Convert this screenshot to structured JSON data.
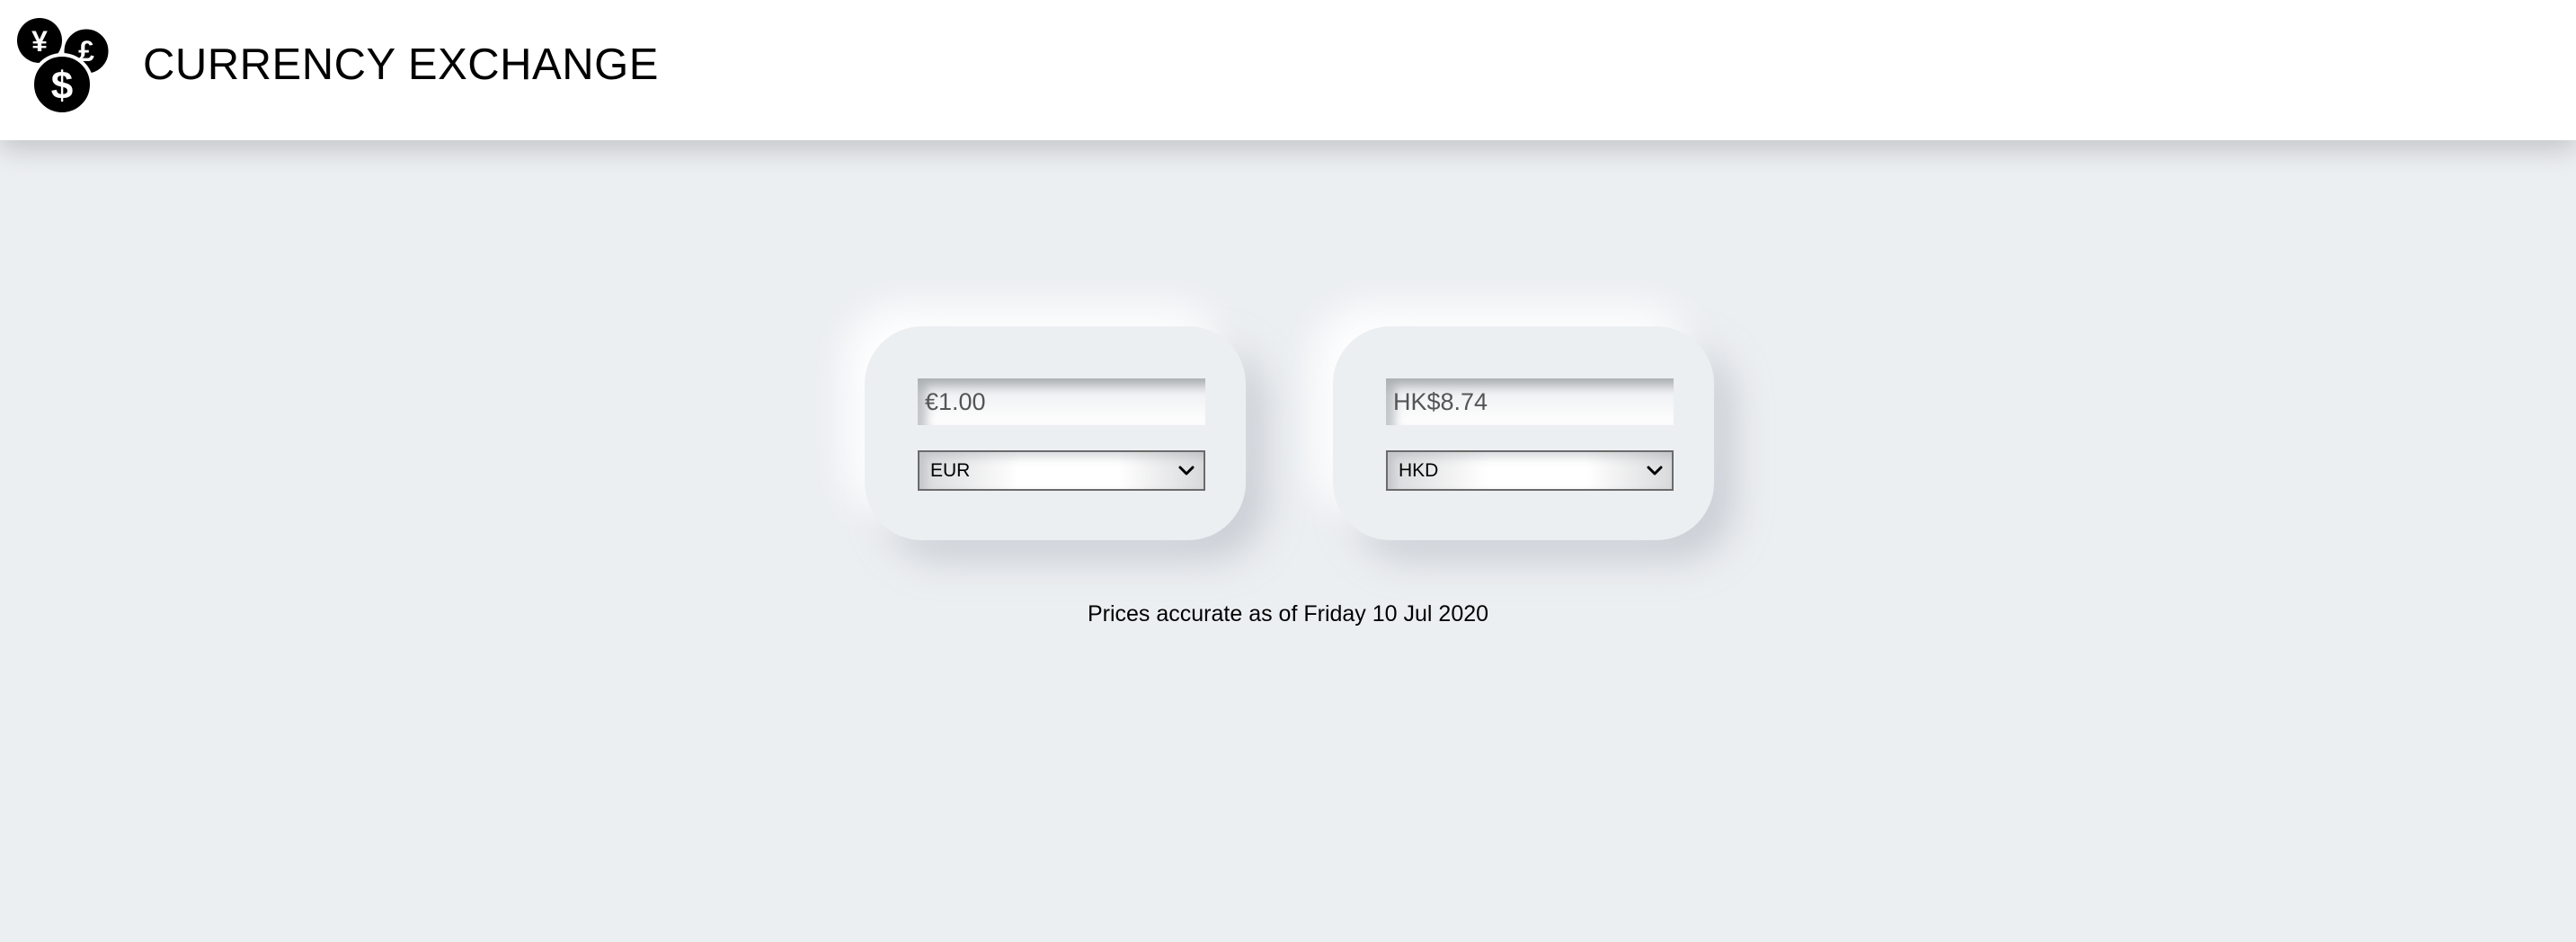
{
  "header": {
    "title": "CURRENCY EXCHANGE",
    "logo_icon": "currency-coins-icon",
    "logo_symbols": [
      "¥",
      "£",
      "$"
    ]
  },
  "converter": {
    "from": {
      "amount": "€1.00",
      "currency": "EUR"
    },
    "to": {
      "amount": "HK$8.74",
      "currency": "HKD"
    }
  },
  "footnote": "Prices accurate as of Friday 10 Jul 2020",
  "colors": {
    "background": "#eceff2",
    "header_bg": "#ffffff",
    "text": "#000000",
    "input_text": "#555555"
  }
}
